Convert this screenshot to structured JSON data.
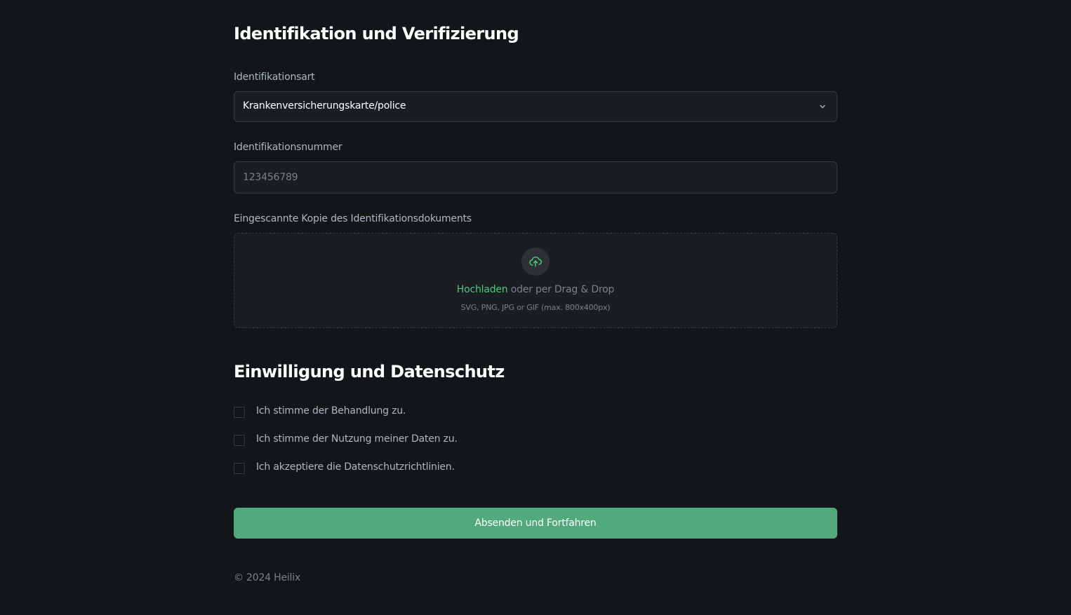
{
  "identification": {
    "title": "Identifikation und Verifizierung",
    "type_label": "Identifikationsart",
    "type_value": "Krankenversicherungskarte/police",
    "number_label": "Identifikationsnummer",
    "number_placeholder": "123456789",
    "upload_label": "Eingescannte Kopie des Identifikationsdokuments",
    "upload_link": "Hochladen",
    "upload_rest": " oder per Drag & Drop",
    "upload_hint": "SVG, PNG, JPG or GIF (max. 800x400px)",
    "upload_icon": "cloud-upload-icon"
  },
  "consent": {
    "title": "Einwilligung und Datenschutz",
    "items": [
      {
        "label": "Ich stimme der Behandlung zu.",
        "checked": false
      },
      {
        "label": "Ich stimme der Nutzung meiner Daten zu.",
        "checked": false
      },
      {
        "label": "Ich akzeptiere die Datenschutzrichtlinien.",
        "checked": false
      }
    ]
  },
  "submit_label": "Absenden und Fortfahren",
  "footer": "© 2024 Heilix",
  "colors": {
    "background": "#131619",
    "field_background": "#1a1d21",
    "border": "#363a3d",
    "accent": "#52a97b",
    "link": "#4ac97e",
    "muted_text": "#76828d",
    "label_text": "#abb8c4"
  }
}
